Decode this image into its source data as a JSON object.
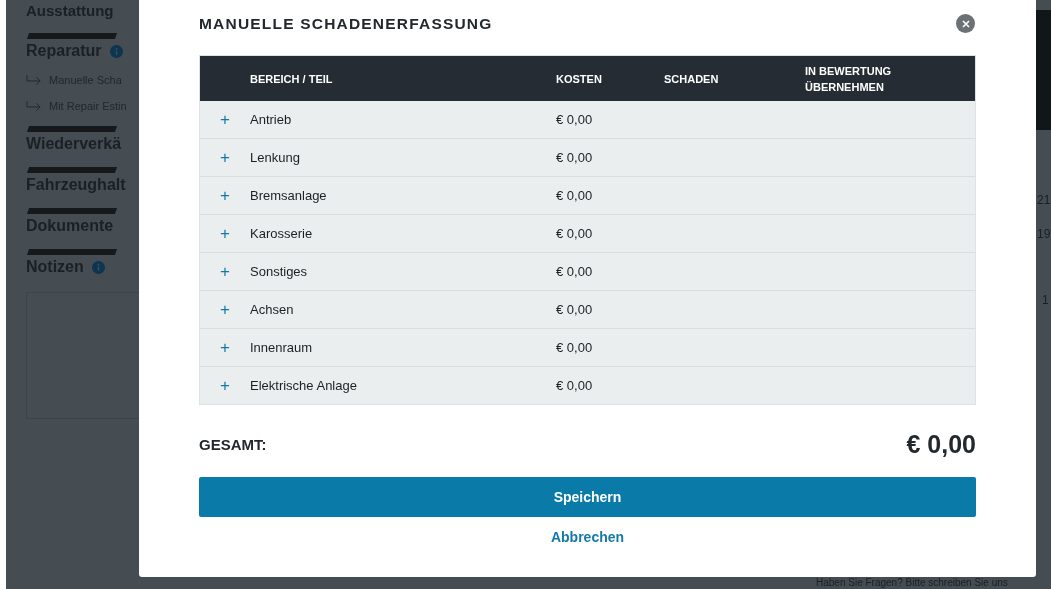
{
  "background": {
    "sections": [
      {
        "title": "Ausstattung"
      },
      {
        "title": "Reparatur",
        "info": true,
        "links": [
          "Manuelle Scha",
          "Mit Repair Estin"
        ]
      },
      {
        "title": "Wiederverkä"
      },
      {
        "title": "Fahrzeughalt"
      },
      {
        "title": "Dokumente"
      },
      {
        "title": "Notizen",
        "info": true
      }
    ],
    "right_values": [
      "21",
      "19",
      "1"
    ],
    "footer": "Haben Sie Fragen? Bitte schreiben Sie uns"
  },
  "dialog": {
    "title": "MANUELLE SCHADENERFASSUNG",
    "table": {
      "columns": [
        "BEREICH / TEIL",
        "KOSTEN",
        "SCHADEN",
        "IN BEWERTUNG ÜBERNEHMEN"
      ],
      "rows": [
        {
          "expand": "+",
          "part": "Antrieb",
          "cost": "€ 0,00"
        },
        {
          "expand": "+",
          "part": "Lenkung",
          "cost": "€ 0,00"
        },
        {
          "expand": "+",
          "part": "Bremsanlage",
          "cost": "€ 0,00"
        },
        {
          "expand": "+",
          "part": "Karosserie",
          "cost": "€ 0,00"
        },
        {
          "expand": "+",
          "part": "Sonstiges",
          "cost": "€ 0,00"
        },
        {
          "expand": "+",
          "part": "Achsen",
          "cost": "€ 0,00"
        },
        {
          "expand": "+",
          "part": "Innenraum",
          "cost": "€ 0,00"
        },
        {
          "expand": "+",
          "part": "Elektrische Anlage",
          "cost": "€ 0,00"
        }
      ]
    },
    "total_label": "GESAMT:",
    "total": "€ 0,00",
    "save_button": "Speichern",
    "cancel_link": "Abbrechen"
  }
}
